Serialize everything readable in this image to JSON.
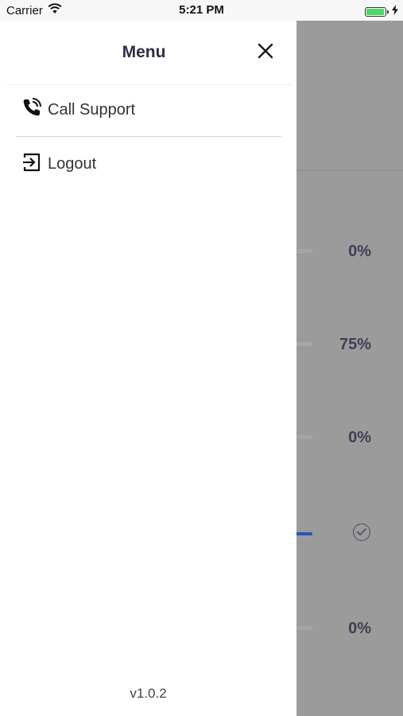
{
  "status_bar": {
    "carrier": "Carrier",
    "time": "5:21 PM",
    "battery_color": "#4cd964",
    "icons": [
      "wifi-icon",
      "battery-icon",
      "charging-icon"
    ]
  },
  "drawer": {
    "title": "Menu",
    "close_icon": "close-icon",
    "items": [
      {
        "label": "Call Support",
        "icon": "phone-call-icon"
      },
      {
        "label": "Logout",
        "icon": "logout-icon"
      }
    ],
    "version": "v1.0.2"
  },
  "background_list": {
    "rows": [
      {
        "value": "0%",
        "progress": 0
      },
      {
        "value": "75%",
        "progress": 0.75
      },
      {
        "value": "0%",
        "progress": 0
      },
      {
        "value": "",
        "progress": 1,
        "status": "completed",
        "icon": "check-circle-icon"
      },
      {
        "value": "0%",
        "progress": 0
      }
    ],
    "accent_color": "#2a56b8"
  }
}
